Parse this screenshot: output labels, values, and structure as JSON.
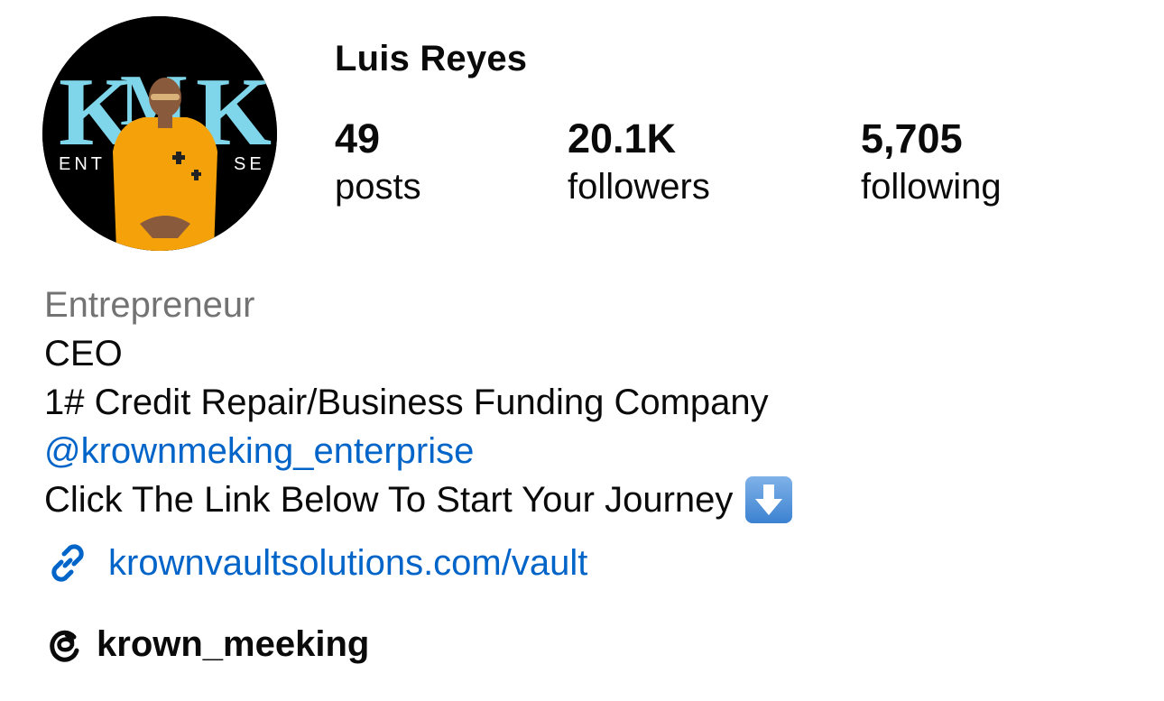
{
  "profile": {
    "name": "Luis Reyes",
    "avatar_alt_brand_letters": "KMK",
    "avatar_brand_word": "ENTERPRISE",
    "avatar_brand_left": "ENT",
    "avatar_brand_right": "SE"
  },
  "stats": [
    {
      "value": "49",
      "label": "posts"
    },
    {
      "value": "20.1K",
      "label": "followers"
    },
    {
      "value": "5,705",
      "label": "following"
    }
  ],
  "bio": {
    "category": "Entrepreneur",
    "line1": "CEO",
    "line2": "1# Credit Repair/Business Funding Company",
    "mention": "@krownmeking_enterprise",
    "line4": "Click The Link Below To Start Your Journey",
    "line4_emoji": "down-arrow-emoji"
  },
  "link": {
    "icon": "link-icon",
    "text": "krownvaultsolutions.com/vault"
  },
  "threads": {
    "icon": "threads-icon",
    "handle": "krown_meeking"
  },
  "colors": {
    "link_blue": "#0064c8",
    "category_gray": "#737373",
    "logo_cyan": "#7fd6ea",
    "shirt_orange": "#f5a20a"
  }
}
